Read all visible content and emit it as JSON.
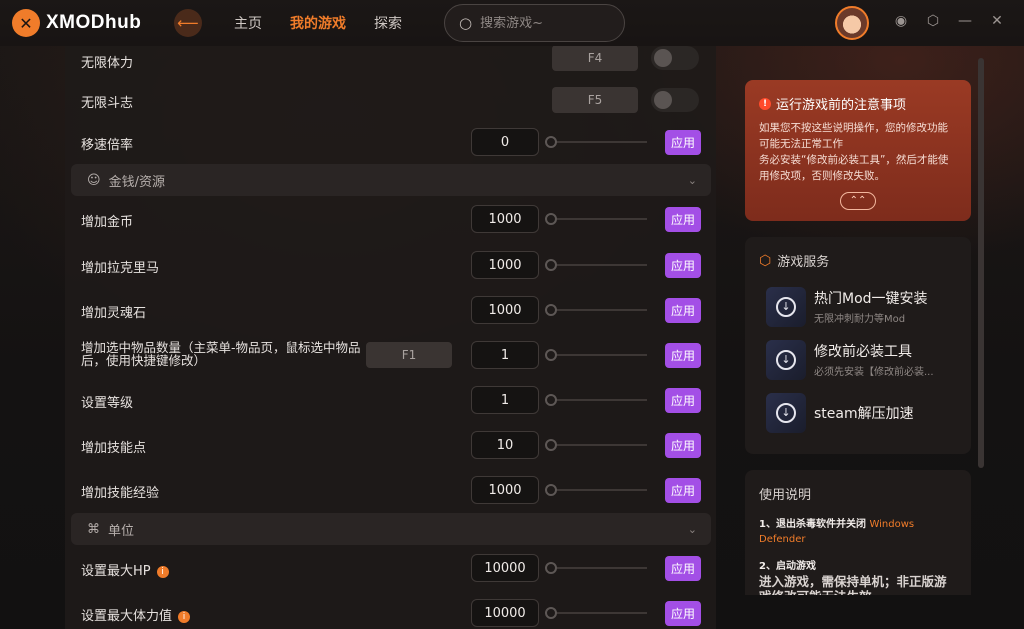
{
  "app": {
    "brand": "XMODhub",
    "accent": "#f07c2a",
    "apply_color": "#a34fe6"
  },
  "nav": {
    "items": [
      "主页",
      "我的游戏",
      "探索"
    ],
    "active": "我的游戏"
  },
  "search": {
    "placeholder": "搜索游戏~"
  },
  "window_icons": [
    "ghost-icon",
    "settings-icon",
    "minimize-icon",
    "close-icon"
  ],
  "rows_top": [
    {
      "label": "无限体力",
      "hotkey": "F4"
    },
    {
      "label": "无限斗志",
      "hotkey": "F5"
    }
  ],
  "speed_row": {
    "label": "移速倍率",
    "value": "0",
    "apply": "应用"
  },
  "sections": {
    "money": "金钱/资源",
    "unit": "单位"
  },
  "money_rows": [
    {
      "label": "增加金币",
      "value": "1000",
      "apply": "应用"
    },
    {
      "label": "增加拉克里马",
      "value": "1000",
      "apply": "应用"
    },
    {
      "label": "增加灵魂石",
      "value": "1000",
      "apply": "应用"
    },
    {
      "label": "增加选中物品数量（主菜单-物品页，鼠标选中物品后，使用快捷键修改）",
      "hotkey": "F1",
      "value": "1",
      "apply": "应用"
    },
    {
      "label": "设置等级",
      "value": "1",
      "apply": "应用"
    },
    {
      "label": "增加技能点",
      "value": "10",
      "apply": "应用"
    },
    {
      "label": "增加技能经验",
      "value": "1000",
      "apply": "应用"
    }
  ],
  "unit_rows": [
    {
      "label": "设置最大HP",
      "value": "10000",
      "apply": "应用"
    },
    {
      "label": "设置最大体力值",
      "value": "10000",
      "apply": "应用"
    }
  ],
  "notice": {
    "title": "运行游戏前的注意事项",
    "line1": "如果您不按这些说明操作，您的修改功能可能无法正常工作",
    "line2": "务必安装“修改前必装工具”，然后才能使用修改项，否则修改失败。"
  },
  "services": {
    "title": "游戏服务",
    "items": [
      {
        "name": "热门Mod一键安装",
        "sub": "无限冲刺耐力等Mod"
      },
      {
        "name": "修改前必装工具",
        "sub": "必须先安装【修改前必装..."
      },
      {
        "name": "steam解压加速",
        "sub": ""
      }
    ]
  },
  "usage": {
    "title": "使用说明",
    "step1_prefix": "1、退出杀毒软件并关闭",
    "step1_highlight": "Windows Defender",
    "step2_title": "2、启动游戏",
    "step2_desc": "进入游戏，需保持单机；非正版游戏修改可能无法生效"
  }
}
